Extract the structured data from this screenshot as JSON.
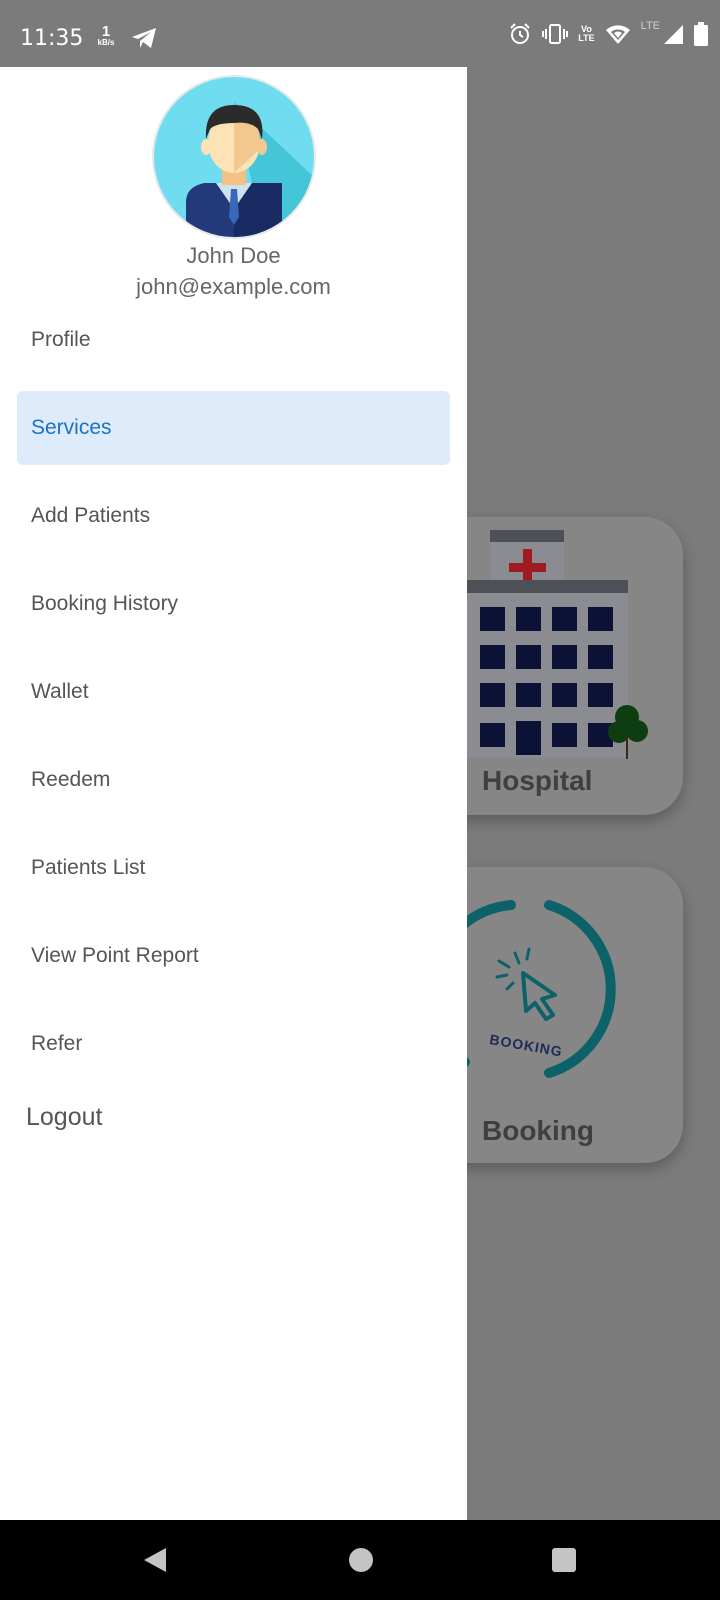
{
  "status_bar": {
    "time": "11:35",
    "data_rate_value": "1",
    "data_rate_unit": "kB/s",
    "volte_top": "Vo",
    "volte_bottom": "LTE",
    "lte_label": "LTE",
    "icons": [
      "telegram-icon",
      "alarm-icon",
      "vibrate-icon",
      "volte-icon",
      "wifi-icon",
      "signal-icon",
      "battery-icon"
    ]
  },
  "drawer": {
    "user": {
      "name": "John Doe",
      "email": "john@example.com"
    },
    "menu": [
      {
        "label": "Profile",
        "active": false
      },
      {
        "label": "Services",
        "active": true
      },
      {
        "label": "Add Patients",
        "active": false
      },
      {
        "label": "Booking History",
        "active": false
      },
      {
        "label": "Wallet",
        "active": false
      },
      {
        "label": "Reedem",
        "active": false
      },
      {
        "label": "Patients List",
        "active": false
      },
      {
        "label": "View Point Report",
        "active": false
      },
      {
        "label": "Refer",
        "active": false
      }
    ],
    "logout_label": "Logout"
  },
  "background": {
    "cards": [
      {
        "label": "Hospital",
        "icon": "hospital-icon"
      },
      {
        "label": "Booking",
        "icon": "booking-icon",
        "badge_text": "BOOKING"
      }
    ]
  },
  "colors": {
    "active_bg": "#deebfb",
    "active_text": "#1a73c8",
    "scrim": "#7b7b7b"
  }
}
